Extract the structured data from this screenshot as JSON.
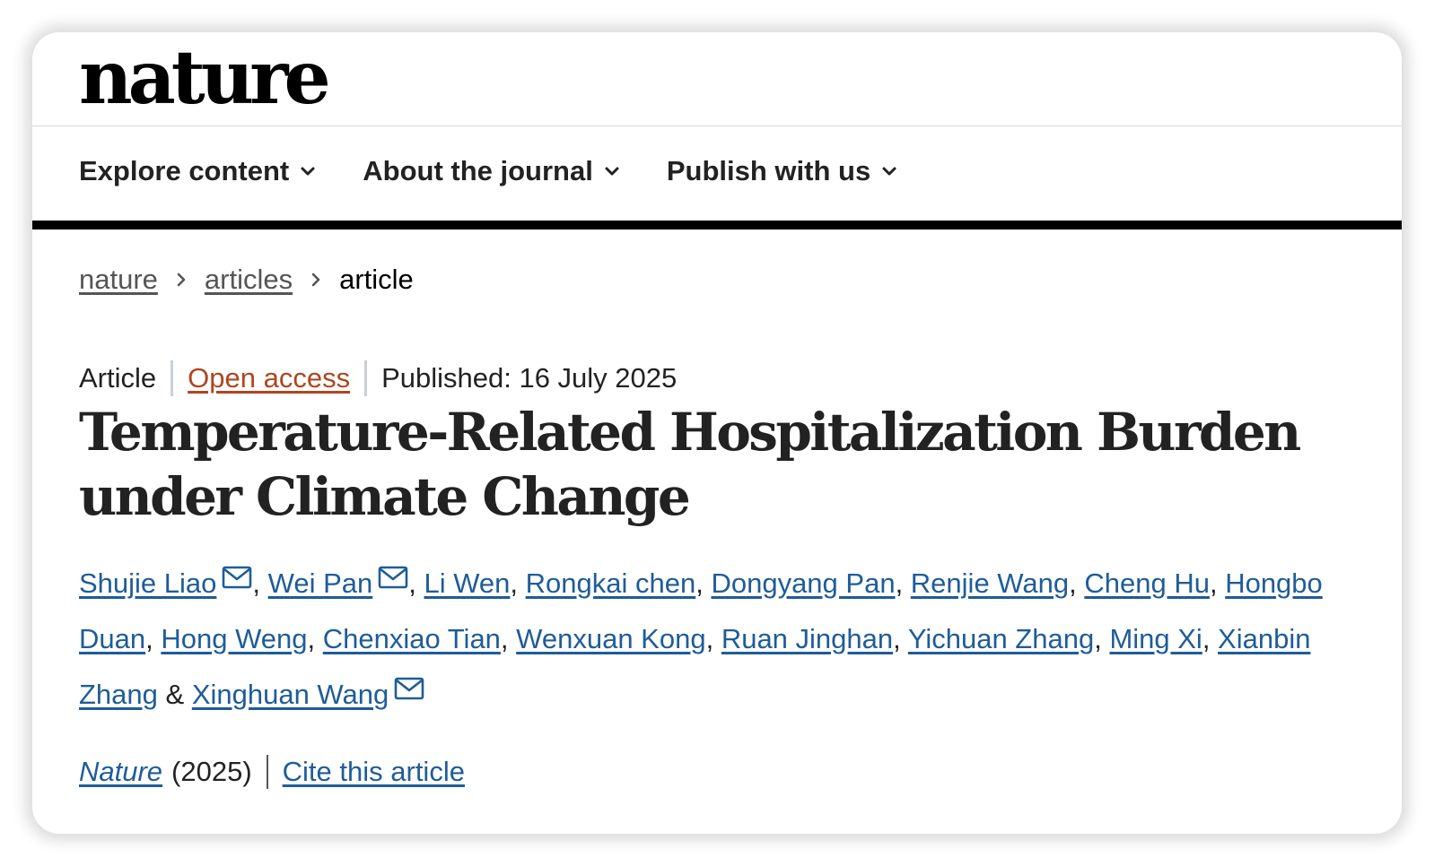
{
  "logo": "nature",
  "nav": {
    "items": [
      {
        "label": "Explore content"
      },
      {
        "label": "About the journal"
      },
      {
        "label": "Publish with us"
      }
    ]
  },
  "breadcrumb": {
    "items": [
      "nature",
      "articles",
      "article"
    ]
  },
  "meta": {
    "type": "Article",
    "access": "Open access",
    "published": "Published: 16 July 2025"
  },
  "article": {
    "title": "Temperature-Related Hospitalization Burden under Climate Change"
  },
  "authors": [
    {
      "name": "Shujie Liao",
      "email": true
    },
    {
      "name": "Wei Pan",
      "email": true
    },
    {
      "name": "Li Wen",
      "email": false
    },
    {
      "name": "Rongkai chen",
      "email": false
    },
    {
      "name": "Dongyang Pan",
      "email": false
    },
    {
      "name": "Renjie Wang",
      "email": false
    },
    {
      "name": "Cheng Hu",
      "email": false
    },
    {
      "name": "Hongbo Duan",
      "email": false
    },
    {
      "name": "Hong Weng",
      "email": false
    },
    {
      "name": "Chenxiao Tian",
      "email": false
    },
    {
      "name": "Wenxuan Kong",
      "email": false
    },
    {
      "name": "Ruan Jinghan",
      "email": false
    },
    {
      "name": "Yichuan Zhang",
      "email": false
    },
    {
      "name": "Ming Xi",
      "email": false
    },
    {
      "name": "Xianbin Zhang",
      "email": false
    },
    {
      "name": "Xinghuan Wang",
      "email": true
    }
  ],
  "authors_separators": {
    "comma": ", ",
    "last": " & "
  },
  "citation": {
    "journal": "Nature",
    "year": "(2025)",
    "cite_label": "Cite this article"
  },
  "colors": {
    "link": "#1f5c99",
    "open_access": "#b0451f",
    "text": "#222222",
    "rule": "#000000"
  }
}
